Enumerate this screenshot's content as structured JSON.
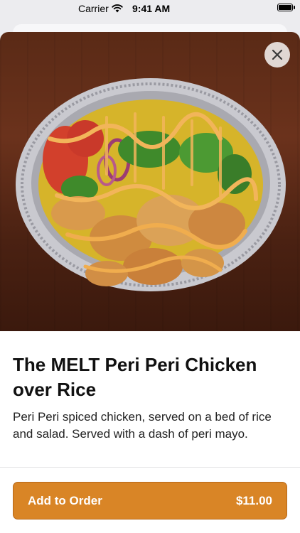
{
  "status_bar": {
    "carrier": "Carrier",
    "time": "9:41 AM",
    "icons": [
      "wifi-icon",
      "battery-icon"
    ]
  },
  "item": {
    "name": "The MELT Peri Peri Chicken over Rice",
    "description": "Peri Peri spiced chicken, served on a bed of rice and salad. Served with a dash of peri mayo.",
    "image_icon": "food-photo"
  },
  "actions": {
    "close_icon": "close-icon",
    "add_label": "Add to Order",
    "price": "$11.00"
  },
  "colors": {
    "accent": "#d98526",
    "accent_border": "#b8691a",
    "background": "#ececef"
  }
}
